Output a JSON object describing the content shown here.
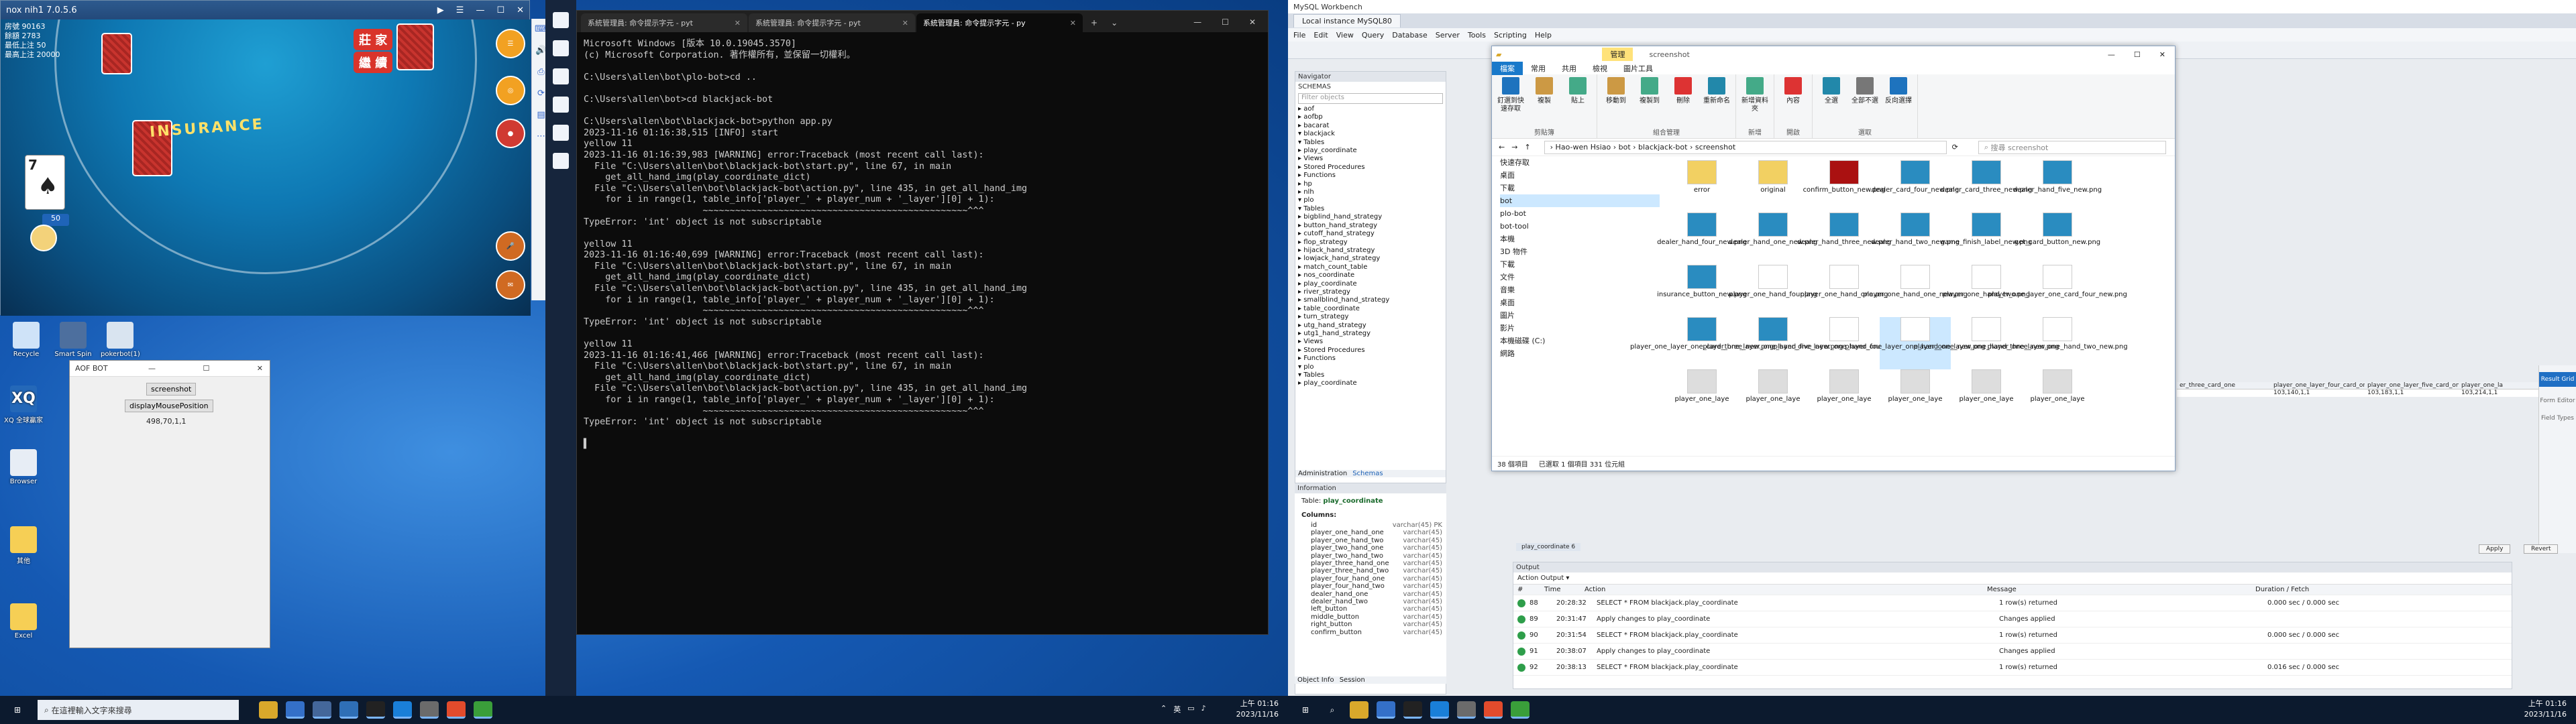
{
  "nox": {
    "title": "nox  nih1 7.0.5.6",
    "room_line": "房號 90163",
    "money_line": "餘額 2783",
    "limit_line": "最低上注 50",
    "max_line": "最高上注 20000",
    "time": "01:16",
    "player_card_rank": "7",
    "bet_chip": "50",
    "btn_split": "莊 家",
    "btn_continue": "繼 續",
    "insurance": "INSURANCE",
    "payout_line": "保險賠2比1"
  },
  "aofbot": {
    "title": "AOF BOT",
    "screenshot_btn": "screenshot",
    "position_btn": "displayMousePosition",
    "coords": "498,70,1,1"
  },
  "desktop_icons_left": [
    {
      "label": "Recycle"
    },
    {
      "label": "Smart Spin"
    },
    {
      "label": "pokerbot(1)"
    },
    {
      "label": "XQ 全球贏家"
    },
    {
      "label": "Browser"
    },
    {
      "label": "其他"
    },
    {
      "label": "Excel"
    },
    {
      "label": "AOF BOT"
    }
  ],
  "terminal": {
    "tabs": [
      "系統管理員: 命令提示字元 - pyt",
      "系統管理員: 命令提示字元 - pyt",
      "系統管理員: 命令提示字元 - py"
    ],
    "lines": [
      "Microsoft Windows [版本 10.0.19045.3570]",
      "(c) Microsoft Corporation. 著作權所有，並保留一切權利。",
      "",
      "C:\\Users\\allen\\bot\\plo-bot>cd ..",
      "",
      "C:\\Users\\allen\\bot>cd blackjack-bot",
      "",
      "C:\\Users\\allen\\bot\\blackjack-bot>python app.py",
      "2023-11-16 01:16:38,515 [INFO] start",
      "yellow 11",
      "2023-11-16 01:16:39,983 [WARNING] error:Traceback (most recent call last):",
      "  File \"C:\\Users\\allen\\bot\\blackjack-bot\\start.py\", line 67, in main",
      "    get_all_hand_img(play_coordinate_dict)",
      "  File \"C:\\Users\\allen\\bot\\blackjack-bot\\action.py\", line 435, in get_all_hand_img",
      "    for i in range(1, table_info['player_' + player_num + '_layer'][0] + 1):",
      "                      ~~~~~~~~~~~~~~~~~~~~~~~~~~~~~~~~~~~~~~~~~~~~~~~~~^^^",
      "TypeError: 'int' object is not subscriptable",
      "",
      "yellow 11",
      "2023-11-16 01:16:40,699 [WARNING] error:Traceback (most recent call last):",
      "  File \"C:\\Users\\allen\\bot\\blackjack-bot\\start.py\", line 67, in main",
      "    get_all_hand_img(play_coordinate_dict)",
      "  File \"C:\\Users\\allen\\bot\\blackjack-bot\\action.py\", line 435, in get_all_hand_img",
      "    for i in range(1, table_info['player_' + player_num + '_layer'][0] + 1):",
      "                      ~~~~~~~~~~~~~~~~~~~~~~~~~~~~~~~~~~~~~~~~~~~~~~~~~^^^",
      "TypeError: 'int' object is not subscriptable",
      "",
      "yellow 11",
      "2023-11-16 01:16:41,466 [WARNING] error:Traceback (most recent call last):",
      "  File \"C:\\Users\\allen\\bot\\blackjack-bot\\start.py\", line 67, in main",
      "    get_all_hand_img(play_coordinate_dict)",
      "  File \"C:\\Users\\allen\\bot\\blackjack-bot\\action.py\", line 435, in get_all_hand_img",
      "    for i in range(1, table_info['player_' + player_num + '_layer'][0] + 1):",
      "                      ~~~~~~~~~~~~~~~~~~~~~~~~~~~~~~~~~~~~~~~~~~~~~~~~~^^^",
      "TypeError: 'int' object is not subscriptable",
      "",
      "▌"
    ]
  },
  "workbench": {
    "title": "MySQL Workbench",
    "connection_tab": "Local instance MySQL80",
    "menu": [
      "File",
      "Edit",
      "View",
      "Query",
      "Database",
      "Server",
      "Tools",
      "Scripting",
      "Help"
    ],
    "navigator_label": "Navigator",
    "schemas_label": "SCHEMAS",
    "filter_placeholder": "Filter objects",
    "tree": [
      "▸ aof",
      "▸ aofbp",
      "▸ bacarat",
      "▾ blackjack",
      "  ▾ Tables",
      "    ▸ play_coordinate",
      "  ▸ Views",
      "  ▸ Stored Procedures",
      "  ▸ Functions",
      "▸ hp",
      "▸ nlh",
      "▾ plo",
      "  ▾ Tables",
      "    ▸ bigblind_hand_strategy",
      "    ▸ button_hand_strategy",
      "    ▸ cutoff_hand_strategy",
      "    ▸ flop_strategy",
      "    ▸ hijack_hand_strategy",
      "    ▸ lowjack_hand_strategy",
      "    ▸ match_count_table",
      "    ▸ nos_coordinate",
      "    ▸ play_coordinate",
      "    ▸ river_strategy",
      "    ▸ smallblind_hand_strategy",
      "    ▸ table_coordinate",
      "    ▸ turn_strategy",
      "    ▸ utg_hand_strategy",
      "    ▸ utg1_hand_strategy",
      "  ▸ Views",
      "  ▸ Stored Procedures",
      "  ▸ Functions",
      "▾ plo",
      "  ▾ Tables",
      "    ▸ play_coordinate"
    ],
    "admin_tab": "Administration",
    "schemas_tab": "Schemas",
    "info_label": "Information",
    "table_label": "Table:",
    "table_name": "play_coordinate",
    "columns_label": "Columns:",
    "columns": [
      [
        "id",
        "varchar(45) PK"
      ],
      [
        "player_one_hand_one",
        "varchar(45)"
      ],
      [
        "player_one_hand_two",
        "varchar(45)"
      ],
      [
        "player_two_hand_one",
        "varchar(45)"
      ],
      [
        "player_two_hand_two",
        "varchar(45)"
      ],
      [
        "player_three_hand_one",
        "varchar(45)"
      ],
      [
        "player_three_hand_two",
        "varchar(45)"
      ],
      [
        "player_four_hand_one",
        "varchar(45)"
      ],
      [
        "player_four_hand_two",
        "varchar(45)"
      ],
      [
        "dealer_hand_one",
        "varchar(45)"
      ],
      [
        "dealer_hand_two",
        "varchar(45)"
      ],
      [
        "left_button",
        "varchar(45)"
      ],
      [
        "middle_button",
        "varchar(45)"
      ],
      [
        "right_button",
        "varchar(45)"
      ],
      [
        "confirm_button",
        "varchar(45)"
      ]
    ],
    "object_info_tab": "Object Info",
    "session_tab": "Session",
    "result_grid_headers": [
      "er_three_card_one",
      "player_one_layer_four_card_one",
      "player_one_layer_five_card_one",
      "player_one_la"
    ],
    "result_grid_values": [
      "103,140,1,1",
      "103,183,1,1",
      "103,214,1,1"
    ],
    "rail": [
      "Result Grid",
      "Form Editor",
      "Field Types"
    ],
    "apply_btn": "Apply",
    "revert_btn": "Revert",
    "query_tab": "play_coordinate 6",
    "output_label": "Output",
    "action_output": "Action Output",
    "output_headers": [
      "#",
      "Time",
      "Action",
      "Message",
      "Duration / Fetch"
    ],
    "output_rows": [
      [
        "88",
        "20:28:32",
        "SELECT * FROM blackjack.play_coordinate",
        "1 row(s) returned",
        "0.000 sec / 0.000 sec"
      ],
      [
        "89",
        "20:31:47",
        "Apply changes to play_coordinate",
        "Changes applied",
        ""
      ],
      [
        "90",
        "20:31:54",
        "SELECT * FROM blackjack.play_coordinate",
        "1 row(s) returned",
        "0.000 sec / 0.000 sec"
      ],
      [
        "91",
        "20:38:07",
        "Apply changes to play_coordinate",
        "Changes applied",
        ""
      ],
      [
        "92",
        "20:38:13",
        "SELECT * FROM blackjack.play_coordinate",
        "1 row(s) returned",
        "0.016 sec / 0.000 sec"
      ]
    ]
  },
  "explorer": {
    "manage_tab": "管理",
    "title": "screenshot",
    "menu": [
      "檔案",
      "常用",
      "共用",
      "檢視",
      "圖片工具"
    ],
    "ribbon_groups": [
      {
        "label": "剪貼簿",
        "buttons": [
          "釘選到快速存取",
          "複製",
          "貼上"
        ]
      },
      {
        "label": "組合管理",
        "buttons": [
          "移動到",
          "複製到",
          "刪除",
          "重新命名"
        ]
      },
      {
        "label": "新增",
        "buttons": [
          "新增資料夾"
        ]
      },
      {
        "label": "開啟",
        "buttons": [
          "內容"
        ]
      },
      {
        "label": "選取",
        "buttons": [
          "全選",
          "全部不選",
          "反向選擇"
        ]
      }
    ],
    "path": "›  Hao-wen Hsiao  ›  bot  ›  blackjack-bot  ›  screenshot",
    "search_placeholder": "搜尋 screenshot",
    "left_items": [
      "快速存取",
      "桌面",
      "下載",
      "bot",
      "plo-bot",
      "bot-tool",
      "本機",
      "3D 物件",
      "下載",
      "文件",
      "音樂",
      "桌面",
      "圖片",
      "影片",
      "本機磁碟 (C:)",
      "網路"
    ],
    "files": [
      "error",
      "original",
      "confirm_button_new.png",
      "dealer_card_four_new.png",
      "dealer_card_three_new.png",
      "dealer_hand_five_new.png",
      "",
      "dealer_hand_four_new.png",
      "dealer_hand_one_new.png",
      "dealer_hand_three_new.png",
      "dealer_hand_two_new.png",
      "game_finish_label_new.png",
      "get_card_button_new.png",
      "",
      "insurance_button_new.png",
      "player_one_hand_four.png",
      "player_one_hand_one.png",
      "player_one_hand_one_new.png",
      "player_one_hand_two.png",
      "player_one_layer_one_card_four_new.png",
      "",
      "player_one_layer_one_card_three_new.png",
      "player_one_layer_one_hand_five_new.png",
      "player_one_layer_one_hand_four_new.png",
      "player_one_layer_one_hand_one_new.png",
      "player_one_layer_one_hand_three_new.png",
      "player_one_layer_one_hand_two_new.png",
      "",
      "player_one_laye",
      "player_one_laye",
      "player_one_laye",
      "player_one_laye",
      "player_one_laye",
      "player_one_laye",
      ""
    ],
    "status_count": "38 個項目",
    "status_sel": "已選取 1 個項目  331 位元組"
  },
  "taskbar": {
    "search_placeholder": "在這裡輸入文字來搜尋",
    "time": "上午 01:16",
    "date": "2023/11/16",
    "ime": "英"
  }
}
